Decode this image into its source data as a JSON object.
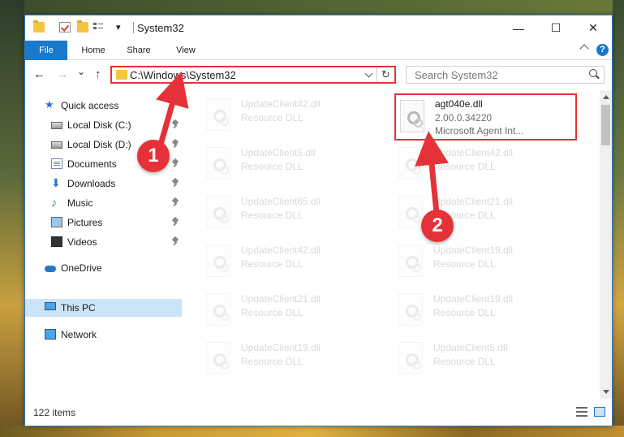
{
  "window": {
    "title": "System32",
    "minimize_glyph": "—",
    "maximize_glyph": "☐",
    "close_glyph": "✕"
  },
  "quick_access_toolbar": {
    "dropdown_glyph": "▾"
  },
  "ribbon": {
    "tabs": [
      "File",
      "Home",
      "Share",
      "View"
    ],
    "help_glyph": "?"
  },
  "navigation": {
    "back_glyph": "←",
    "forward_glyph": "→",
    "recent_glyph": "⌄",
    "up_glyph": "↑",
    "address": "C:\\Windows\\System32",
    "refresh_glyph": "↻",
    "search_placeholder": "Search System32"
  },
  "sidebar": {
    "items": [
      {
        "label": "Quick access",
        "icon": "star-icon",
        "pinned": false
      },
      {
        "label": "Local Disk (C:)",
        "icon": "disk-icon",
        "pinned": true
      },
      {
        "label": "Local Disk (D:)",
        "icon": "disk-icon",
        "pinned": true
      },
      {
        "label": "Documents",
        "icon": "documents-icon",
        "pinned": true
      },
      {
        "label": "Downloads",
        "icon": "downloads-icon",
        "pinned": true
      },
      {
        "label": "Music",
        "icon": "music-icon",
        "pinned": true
      },
      {
        "label": "Pictures",
        "icon": "pictures-icon",
        "pinned": true
      },
      {
        "label": "Videos",
        "icon": "videos-icon",
        "pinned": true
      },
      {
        "label": "OneDrive",
        "icon": "onedrive-icon",
        "pinned": false
      },
      {
        "label": "This PC",
        "icon": "this-pc-icon",
        "pinned": false,
        "selected": true
      },
      {
        "label": "Network",
        "icon": "network-icon",
        "pinned": false
      }
    ]
  },
  "files": {
    "left_column": [
      {
        "name": "UpdateClient42.dll",
        "desc": "Resource DLL"
      },
      {
        "name": "UpdateClient5.dll",
        "desc": "Resource DLL"
      },
      {
        "name": "UpdateClient65.dll",
        "desc": "Resource DLL"
      },
      {
        "name": "UpdateClient42.dll",
        "desc": "Resource DLL"
      },
      {
        "name": "UpdateClient21.dll",
        "desc": "Resource DLL"
      },
      {
        "name": "UpdateClient19.dll",
        "desc": "Resource DLL"
      }
    ],
    "right_column": [
      {
        "name": "agt040e.dll",
        "version": "2.00.0.34220",
        "desc": "Microsoft Agent Int...",
        "highlighted": true
      },
      {
        "name": "UpdateClient42.dll",
        "desc": "Resource DLL"
      },
      {
        "name": "UpdateClient21.dll",
        "desc": "Resource DLL"
      },
      {
        "name": "UpdateClient19.dll",
        "desc": "Resource DLL"
      },
      {
        "name": "UpdateClient19.dll",
        "desc": "Resource DLL"
      },
      {
        "name": "UpdateClient5.dll",
        "desc": "Resource DLL"
      }
    ]
  },
  "status": {
    "item_count": "122 items"
  },
  "annotations": {
    "callout_1": "1",
    "callout_2": "2",
    "color": "#e53238"
  },
  "colors": {
    "accent": "#1979ca",
    "selection": "#cce4f7",
    "highlight_box": "#e53238"
  }
}
